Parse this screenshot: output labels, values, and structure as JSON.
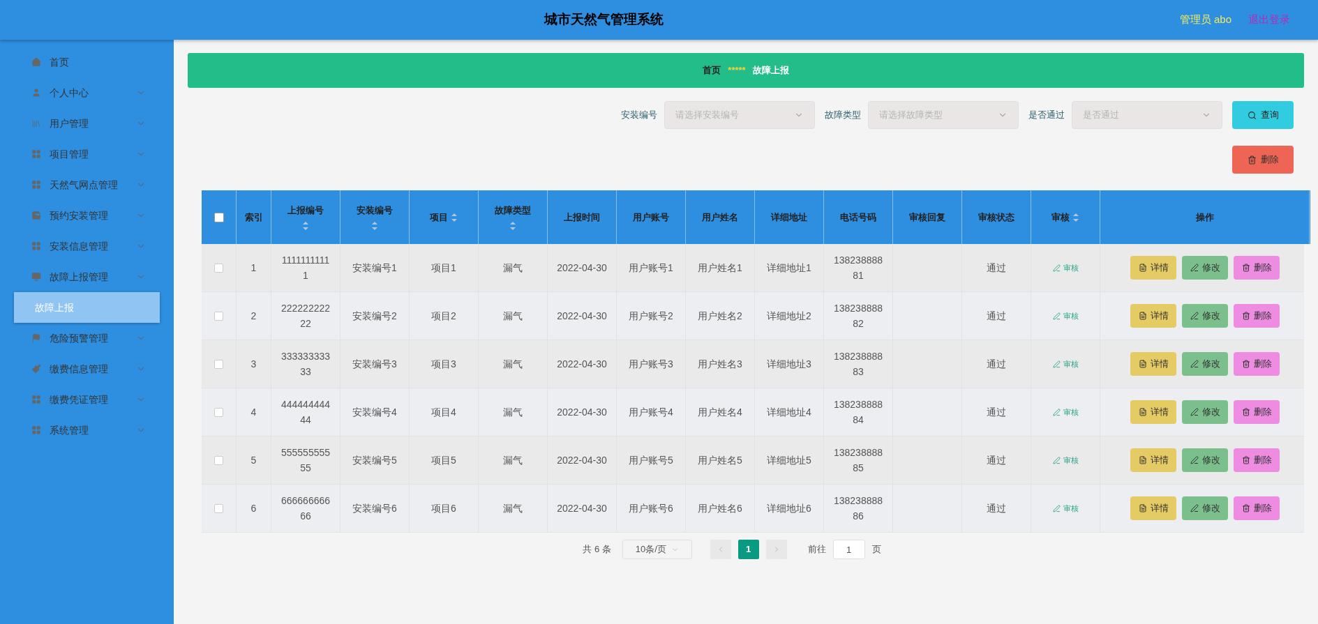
{
  "header": {
    "title": "城市天然气管理系统",
    "user": "管理员 abo",
    "logout": "退出登录"
  },
  "sidebar": {
    "items": [
      {
        "label": "首页",
        "kind": "link"
      },
      {
        "label": "个人中心",
        "kind": "menu"
      },
      {
        "label": "用户管理",
        "kind": "menu"
      },
      {
        "label": "项目管理",
        "kind": "menu"
      },
      {
        "label": "天然气网点管理",
        "kind": "menu"
      },
      {
        "label": "预约安装管理",
        "kind": "menu"
      },
      {
        "label": "安装信息管理",
        "kind": "menu"
      },
      {
        "label": "故障上报管理",
        "kind": "menu",
        "children": [
          {
            "label": "故障上报",
            "selected": true
          }
        ]
      },
      {
        "label": "危险预警管理",
        "kind": "menu"
      },
      {
        "label": "缴费信息管理",
        "kind": "menu"
      },
      {
        "label": "缴费凭证管理",
        "kind": "menu"
      },
      {
        "label": "系统管理",
        "kind": "menu"
      }
    ]
  },
  "breadcrumb": {
    "home": "首页",
    "separator": "*****",
    "current": "故障上报"
  },
  "filters": [
    {
      "label": "安装编号",
      "placeholder": "请选择安装编号"
    },
    {
      "label": "故障类型",
      "placeholder": "请选择故障类型"
    },
    {
      "label": "是否通过",
      "placeholder": "是否通过"
    }
  ],
  "search_button": "查询",
  "delete_button": "删除",
  "table": {
    "all_selected": false,
    "columns": [
      {
        "label": "索引",
        "sortable": false
      },
      {
        "label": "上报编号",
        "sortable": true
      },
      {
        "label": "安装编号",
        "sortable": true
      },
      {
        "label": "项目",
        "sortable": true
      },
      {
        "label": "故障类型",
        "sortable": true
      },
      {
        "label": "上报时间",
        "sortable": false
      },
      {
        "label": "用户账号",
        "sortable": false
      },
      {
        "label": "用户姓名",
        "sortable": false
      },
      {
        "label": "详细地址",
        "sortable": false
      },
      {
        "label": "电话号码",
        "sortable": false
      },
      {
        "label": "审核回复",
        "sortable": false
      },
      {
        "label": "审核状态",
        "sortable": false
      },
      {
        "label": "审核",
        "sortable": true
      },
      {
        "label": "操作",
        "sortable": false
      }
    ],
    "rows": [
      {
        "selected": false,
        "cells": [
          "1",
          "11111111111",
          "安装编号1",
          "项目1",
          "漏气",
          "2022-04-30",
          "用户账号1",
          "用户姓名1",
          "详细地址1",
          "13823888881",
          "",
          "通过"
        ],
        "review": "审核",
        "actions": [
          "详情",
          "修改",
          "删除"
        ]
      },
      {
        "selected": false,
        "cells": [
          "2",
          "22222222222",
          "安装编号2",
          "项目2",
          "漏气",
          "2022-04-30",
          "用户账号2",
          "用户姓名2",
          "详细地址2",
          "13823888882",
          "",
          "通过"
        ],
        "review": "审核",
        "actions": [
          "详情",
          "修改",
          "删除"
        ]
      },
      {
        "selected": false,
        "cells": [
          "3",
          "33333333333",
          "安装编号3",
          "项目3",
          "漏气",
          "2022-04-30",
          "用户账号3",
          "用户姓名3",
          "详细地址3",
          "13823888883",
          "",
          "通过"
        ],
        "review": "审核",
        "actions": [
          "详情",
          "修改",
          "删除"
        ]
      },
      {
        "selected": false,
        "cells": [
          "4",
          "44444444444",
          "安装编号4",
          "项目4",
          "漏气",
          "2022-04-30",
          "用户账号4",
          "用户姓名4",
          "详细地址4",
          "13823888884",
          "",
          "通过"
        ],
        "review": "审核",
        "actions": [
          "详情",
          "修改",
          "删除"
        ]
      },
      {
        "selected": false,
        "cells": [
          "5",
          "55555555555",
          "安装编号5",
          "项目5",
          "漏气",
          "2022-04-30",
          "用户账号5",
          "用户姓名5",
          "详细地址5",
          "13823888885",
          "",
          "通过"
        ],
        "review": "审核",
        "actions": [
          "详情",
          "修改",
          "删除"
        ]
      },
      {
        "selected": false,
        "cells": [
          "6",
          "66666666666",
          "安装编号6",
          "项目6",
          "漏气",
          "2022-04-30",
          "用户账号6",
          "用户姓名6",
          "详细地址6",
          "13823888886",
          "",
          "通过"
        ],
        "review": "审核",
        "actions": [
          "详情",
          "修改",
          "删除"
        ]
      }
    ]
  },
  "pagination": {
    "total": "共 6 条",
    "page_size": "10条/页",
    "pages": [
      {
        "label": "1",
        "selected": true
      }
    ],
    "goto": "前往",
    "goto_value": "1",
    "page_unit": "页"
  }
}
